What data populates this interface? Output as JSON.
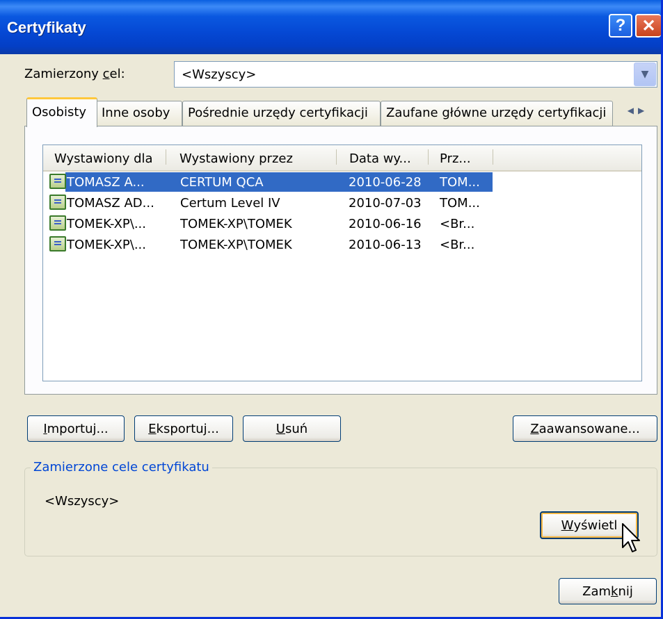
{
  "window": {
    "title": "Certyfikaty",
    "help_button": "?",
    "close_button": "✕"
  },
  "purpose": {
    "label_prefix": "Zamierzony ",
    "label_underlined": "c",
    "label_suffix": "el:",
    "value": "<Wszyscy>"
  },
  "tabs": [
    {
      "label": "Osobisty",
      "active": true
    },
    {
      "label": "Inne osoby",
      "active": false
    },
    {
      "label": "Pośrednie urzędy certyfikacji",
      "active": false
    },
    {
      "label": "Zaufane główne urzędy certyfikacji",
      "active": false
    }
  ],
  "tab_scroll": {
    "left": "◀",
    "right": "▶"
  },
  "list": {
    "columns": [
      "Wystawiony dla",
      "Wystawiony przez",
      "Data wy...",
      "Prz..."
    ],
    "rows": [
      {
        "issued_to": "TOMASZ  A...",
        "issued_by": "CERTUM QCA",
        "date": "2010-06-28",
        "name": "TOM...",
        "selected": true
      },
      {
        "issued_to": "TOMASZ AD...",
        "issued_by": "Certum Level IV",
        "date": "2010-07-03",
        "name": "TOM...",
        "selected": false
      },
      {
        "issued_to": "TOMEK-XP\\...",
        "issued_by": "TOMEK-XP\\TOMEK",
        "date": "2010-06-16",
        "name": "<Br...",
        "selected": false
      },
      {
        "issued_to": "TOMEK-XP\\...",
        "issued_by": "TOMEK-XP\\TOMEK",
        "date": "2010-06-13",
        "name": "<Br...",
        "selected": false
      }
    ]
  },
  "buttons": {
    "import": {
      "u": "I",
      "rest": "mportuj..."
    },
    "export": {
      "u": "E",
      "rest": "ksportuj..."
    },
    "delete": {
      "u": "U",
      "rest": "suń"
    },
    "advanced": {
      "u": "Z",
      "rest": "aawansowane..."
    },
    "view": {
      "u": "W",
      "rest": "yświetl"
    },
    "close": {
      "pre": "Zam",
      "u": "k",
      "rest": "nij"
    }
  },
  "purposes_group": {
    "title": "Zamierzone cele certyfikatu",
    "value": "<Wszyscy>"
  },
  "colors": {
    "title_bar": "#0548d4",
    "selection": "#316ac5",
    "dialog_bg": "#ece9d8",
    "group_title": "#0046d5"
  }
}
